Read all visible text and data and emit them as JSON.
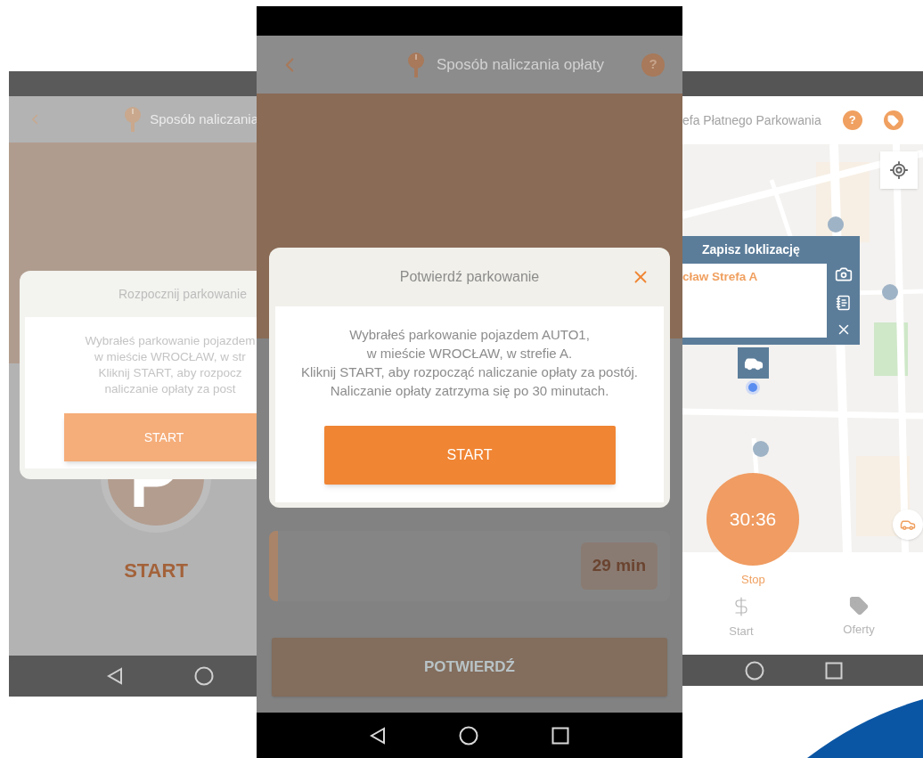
{
  "left_screen": {
    "header": {
      "title": "Sposób naliczania"
    },
    "dialog": {
      "title": "Rozpocznij parkowanie",
      "message": "Wybrałeś parkowanie pojazdem\nw mieście WROCŁAW, w str\nKliknij START, aby rozpocz\nnaliczanie opłaty za post",
      "button": "START"
    },
    "start_label": "START"
  },
  "center_screen": {
    "header": {
      "title": "Sposób naliczania opłaty",
      "help": "?"
    },
    "dialog": {
      "title": "Potwierdź parkowanie",
      "message": "Wybrałeś parkowanie pojazdem AUTO1,\nw mieście WROCŁAW, w strefie A.\nKliknij START, aby rozpocząć naliczanie opłaty za postój.\nNaliczanie opłaty zatrzyma się po 30 minutach.",
      "button": "START"
    },
    "duration": "29 min",
    "confirm_button": "POTWIERDŹ"
  },
  "right_screen": {
    "header": {
      "title": "efa Płatnego Parkowania",
      "help": "?"
    },
    "popup": {
      "title": "Zapisz loklizację",
      "value": "cław Strefa A"
    },
    "timer": "30:36",
    "stop_label": "Stop",
    "nav": [
      {
        "kind": "start",
        "label": "Start"
      },
      {
        "kind": "offers",
        "label": "Oferty"
      }
    ]
  }
}
